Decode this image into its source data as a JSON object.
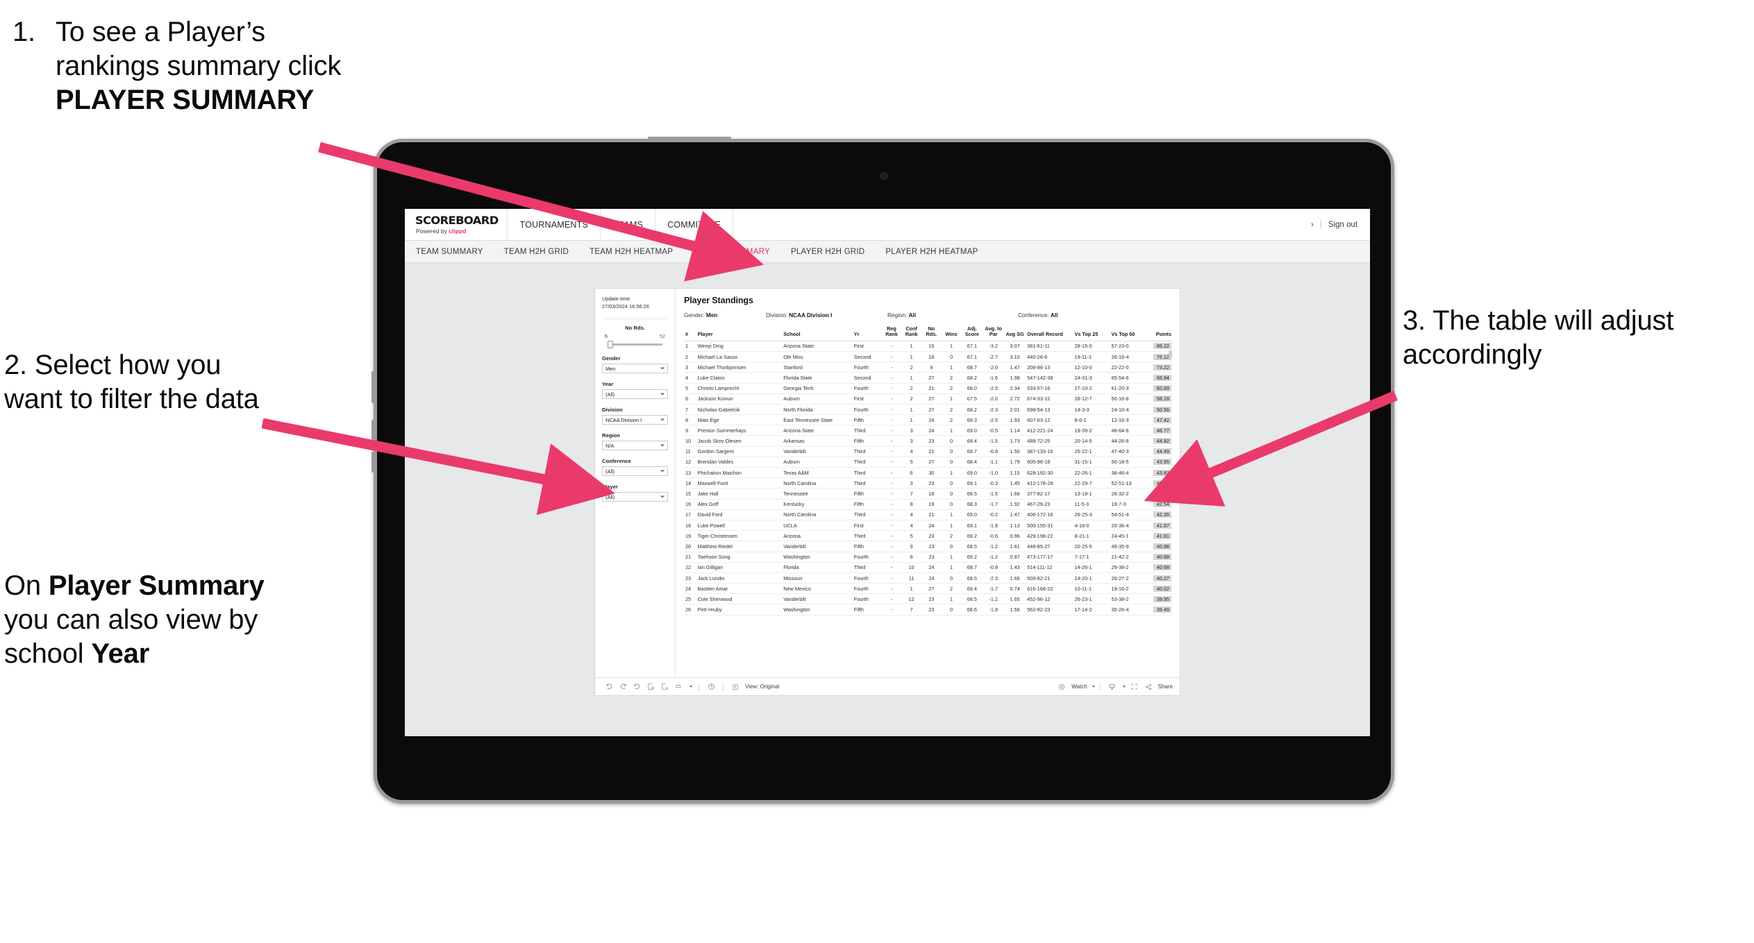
{
  "annotations": {
    "step1": {
      "number": "1.",
      "text_before": "To see a Player’s rankings summary click ",
      "bold": "PLAYER SUMMARY"
    },
    "step2": {
      "text": "2. Select how you want to filter the data"
    },
    "step2b": {
      "p1": "On ",
      "b1": "Player Summary",
      "p2": " you can also view by school ",
      "b2": "Year"
    },
    "step3": {
      "text": "3. The table will adjust accordingly"
    }
  },
  "topbar": {
    "brand_title": "SCOREBOARD",
    "brand_sub_prefix": "Powered by ",
    "brand_sub_brand": "clippd",
    "nav": [
      "TOURNAMENTS",
      "TEAMS",
      "COMMITTEE"
    ],
    "right_icon": "›",
    "separator": "|",
    "sign_out": "Sign out"
  },
  "subnav": {
    "items": [
      {
        "label": "TEAM SUMMARY",
        "active": false
      },
      {
        "label": "TEAM H2H GRID",
        "active": false
      },
      {
        "label": "TEAM H2H HEATMAP",
        "active": false
      },
      {
        "label": "PLAYER SUMMARY",
        "active": true
      },
      {
        "label": "PLAYER H2H GRID",
        "active": false
      },
      {
        "label": "PLAYER H2H HEATMAP",
        "active": false
      }
    ],
    "active_color": "#ec2e63"
  },
  "filters": {
    "update_label": "Update time:",
    "update_value": "27/03/2024 16:56:26",
    "slider": {
      "label": "No Rds.",
      "min": "6",
      "max": "52"
    },
    "selects": [
      {
        "label": "Gender",
        "value": "Men"
      },
      {
        "label": "Year",
        "value": "(All)"
      },
      {
        "label": "Division",
        "value": "NCAA Division I"
      },
      {
        "label": "Region",
        "value": "N/A"
      },
      {
        "label": "Conference",
        "value": "(All)"
      },
      {
        "label": "Player",
        "value": "(All)"
      }
    ]
  },
  "dashboard": {
    "title": "Player Standings",
    "meta": [
      {
        "label": "Gender:",
        "value": "Men"
      },
      {
        "label": "Division:",
        "value": "NCAA Division I"
      },
      {
        "label": "Region:",
        "value": "All"
      },
      {
        "label": "Conference:",
        "value": "All"
      }
    ],
    "columns": [
      "#",
      "Player",
      "School",
      "Yr",
      "Reg Rank",
      "Conf Rank",
      "No Rds.",
      "Wins",
      "Adj. Score",
      "Avg. to Par",
      "Avg SG",
      "Overall Record",
      "Vs Top 25",
      "Vs Top 50",
      "Points"
    ],
    "rows": [
      [
        "1",
        "Wenyi Ding",
        "Arizona State",
        "First",
        "-",
        "1",
        "15",
        "1",
        "67.1",
        "-3.2",
        "3.07",
        "381-61-11",
        "28-15-0",
        "57-23-0",
        "88.22"
      ],
      [
        "2",
        "Michael La Sasso",
        "Ole Miss",
        "Second",
        "-",
        "1",
        "18",
        "0",
        "67.1",
        "-2.7",
        "3.10",
        "440-26-6",
        "19-11-1",
        "35-16-4",
        "76.12"
      ],
      [
        "3",
        "Michael Thorbjornsen",
        "Stanford",
        "Fourth",
        "-",
        "2",
        "9",
        "1",
        "68.7",
        "-2.0",
        "1.47",
        "208-86-13",
        "12-10-0",
        "22-22-0",
        "73.22"
      ],
      [
        "4",
        "Luke Claton",
        "Florida State",
        "Second",
        "-",
        "1",
        "27",
        "2",
        "68.2",
        "-1.6",
        "1.98",
        "547-142-38",
        "24-31-3",
        "65-54-6",
        "66.94"
      ],
      [
        "5",
        "Christo Lamprecht",
        "Georgia Tech",
        "Fourth",
        "-",
        "2",
        "21",
        "2",
        "68.0",
        "-2.5",
        "2.34",
        "533-57-16",
        "27-10-2",
        "61-20-3",
        "60.89"
      ],
      [
        "6",
        "Jackson Koivun",
        "Auburn",
        "First",
        "-",
        "2",
        "27",
        "1",
        "67.5",
        "-2.0",
        "2.72",
        "674-33-12",
        "28-12-7",
        "50-16-8",
        "58.18"
      ],
      [
        "7",
        "Nicholas Gabrelcik",
        "North Florida",
        "Fourth",
        "-",
        "1",
        "27",
        "2",
        "68.2",
        "-2.3",
        "2.01",
        "698-54-13",
        "14-3-3",
        "24-10-4",
        "50.56"
      ],
      [
        "8",
        "Mats Ege",
        "East Tennessee State",
        "Fifth",
        "-",
        "1",
        "24",
        "2",
        "68.3",
        "-2.5",
        "1.93",
        "607-63-12",
        "8-6-1",
        "12-16-3",
        "47.42"
      ],
      [
        "9",
        "Preston Summerhays",
        "Arizona State",
        "Third",
        "-",
        "3",
        "24",
        "1",
        "69.0",
        "-0.5",
        "1.14",
        "412-221-24",
        "19-39-2",
        "46-64-6",
        "46.77"
      ],
      [
        "10",
        "Jacob Skov Olesen",
        "Arkansas",
        "Fifth",
        "-",
        "3",
        "23",
        "0",
        "68.4",
        "-1.5",
        "1.73",
        "488-72-25",
        "20-14-5",
        "44-26-8",
        "44.82"
      ],
      [
        "11",
        "Gordon Sargent",
        "Vanderbilt",
        "Third",
        "-",
        "4",
        "21",
        "0",
        "68.7",
        "-0.8",
        "1.50",
        "387-133-16",
        "25-22-1",
        "47-40-3",
        "44.49"
      ],
      [
        "12",
        "Brendan Valdes",
        "Auburn",
        "Third",
        "-",
        "5",
        "27",
        "0",
        "68.4",
        "-1.1",
        "1.79",
        "605-96-18",
        "31-15-1",
        "50-18-5",
        "43.95"
      ],
      [
        "13",
        "Phichaksn Maichon",
        "Texas A&M",
        "Third",
        "-",
        "6",
        "30",
        "1",
        "69.0",
        "-1.0",
        "1.15",
        "628-192-30",
        "22-26-1",
        "38-46-4",
        "43.83"
      ],
      [
        "14",
        "Maxwell Ford",
        "North Carolina",
        "Third",
        "-",
        "3",
        "23",
        "0",
        "69.1",
        "-0.3",
        "1.45",
        "412-178-28",
        "22-29-7",
        "52-51-10",
        "42.75"
      ],
      [
        "15",
        "Jake Hall",
        "Tennessee",
        "Fifth",
        "-",
        "7",
        "18",
        "0",
        "68.5",
        "-1.5",
        "1.66",
        "377-82-17",
        "13-18-1",
        "26-32-2",
        "42.55"
      ],
      [
        "16",
        "Alex Goff",
        "Kentucky",
        "Fifth",
        "-",
        "8",
        "19",
        "0",
        "68.3",
        "-1.7",
        "1.92",
        "467-29-23",
        "11-5-3",
        "18-7-3",
        "42.54"
      ],
      [
        "17",
        "David Ford",
        "North Carolina",
        "Third",
        "-",
        "4",
        "21",
        "1",
        "69.0",
        "-0.2",
        "1.47",
        "406-172-16",
        "26-25-3",
        "54-51-4",
        "42.35"
      ],
      [
        "18",
        "Luke Powell",
        "UCLA",
        "First",
        "-",
        "4",
        "24",
        "1",
        "69.1",
        "-1.8",
        "1.13",
        "500-155-31",
        "4-18-0",
        "20-36-4",
        "41.87"
      ],
      [
        "19",
        "Tiger Christensen",
        "Arizona",
        "Third",
        "-",
        "5",
        "23",
        "2",
        "69.2",
        "-0.6",
        "0.96",
        "429-198-22",
        "8-21-1",
        "24-45-1",
        "41.81"
      ],
      [
        "20",
        "Matthew Riedel",
        "Vanderbilt",
        "Fifth",
        "-",
        "9",
        "23",
        "0",
        "68.5",
        "-1.2",
        "1.61",
        "448-85-27",
        "20-25-5",
        "49-35-9",
        "40.98"
      ],
      [
        "21",
        "Taehoon Song",
        "Washington",
        "Fourth",
        "-",
        "6",
        "23",
        "1",
        "69.2",
        "-1.2",
        "0.87",
        "473-177-17",
        "7-17-1",
        "21-42-2",
        "40.88"
      ],
      [
        "22",
        "Ian Gilligan",
        "Florida",
        "Third",
        "-",
        "10",
        "24",
        "1",
        "68.7",
        "-0.8",
        "1.43",
        "514-111-12",
        "14-26-1",
        "29-38-2",
        "40.68"
      ],
      [
        "23",
        "Jack Lundin",
        "Missouri",
        "Fourth",
        "-",
        "11",
        "24",
        "0",
        "68.5",
        "-2.3",
        "1.68",
        "509-82-21",
        "14-20-1",
        "26-27-2",
        "40.27"
      ],
      [
        "24",
        "Bastien Amat",
        "New Mexico",
        "Fourth",
        "-",
        "1",
        "27",
        "2",
        "69.4",
        "-1.7",
        "0.74",
        "616-168-22",
        "10-11-1",
        "19-16-2",
        "40.02"
      ],
      [
        "25",
        "Cole Sherwood",
        "Vanderbilt",
        "Fourth",
        "-",
        "12",
        "23",
        "1",
        "68.5",
        "-1.2",
        "1.65",
        "452-96-12",
        "26-23-1",
        "53-38-2",
        "39.95"
      ],
      [
        "26",
        "Petr Hruby",
        "Washington",
        "Fifth",
        "-",
        "7",
        "23",
        "0",
        "68.6",
        "-1.8",
        "1.56",
        "562-82-23",
        "17-14-2",
        "35-26-4",
        "39.49"
      ]
    ]
  },
  "toolbar": {
    "icons": [
      "undo-icon",
      "redo-icon",
      "revert-icon",
      "refresh-data-icon",
      "pause-updates-icon",
      "custom-view-icon"
    ],
    "view_label": "View: Original",
    "watch_label": "Watch",
    "share_label": "Share"
  },
  "colors": {
    "accent_pink": "#ec2e63",
    "arrow_pink": "#ea3a6b",
    "app_bg": "#e7e8ea",
    "points_highlight": "#d5d6d8"
  }
}
